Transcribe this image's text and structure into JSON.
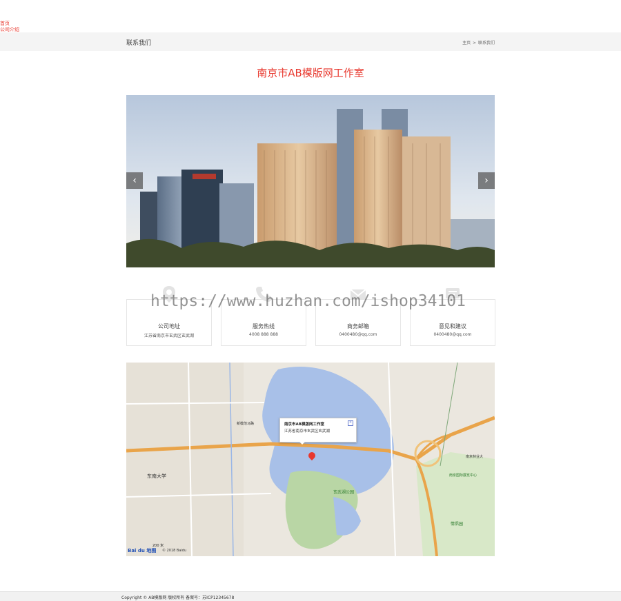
{
  "nav": {
    "home": "首页",
    "about": "公司介绍"
  },
  "header": {
    "title": "联系我们",
    "breadcrumb_home": "主页",
    "breadcrumb_sep": ">",
    "breadcrumb_current": "联系我们"
  },
  "company_name": "南京市AB模版网工作室",
  "banner": {
    "prev": "‹",
    "next": "›"
  },
  "watermark": "https://www.huzhan.com/ishop34101",
  "contact_cards": [
    {
      "icon": "location-pin-icon",
      "label": "公司地址",
      "value": "江苏省南京市玄武区玄武湖"
    },
    {
      "icon": "phone-icon",
      "label": "服务热线",
      "value": "4008 888 888"
    },
    {
      "icon": "mail-icon",
      "label": "商务邮箱",
      "value": "0400480@qq.com"
    },
    {
      "icon": "message-icon",
      "label": "意见和建议",
      "value": "0400480@qq.com"
    }
  ],
  "map": {
    "popup_title": "南京市AB模版网工作室",
    "popup_address": "江苏省南京市玄武区玄武湖",
    "popup_close": "×",
    "provider": "Bai du 地图",
    "scale": "200 米",
    "copyright": "© 2018 Baidu",
    "labels": {
      "park": "玄武湖公园",
      "university": "东南大学",
      "center": "南京国际展览中心",
      "forest_univ": "南京林业大",
      "love_garden": "情侣园",
      "xinmofan": "新模范马路"
    }
  },
  "footer": {
    "copyright": "Copyright © AB模版网 版权所有 备案号：苏ICP12345678"
  },
  "colors": {
    "accent": "#e8382e",
    "crumb_bg": "#f4f4f4",
    "lake": "#a8c0e8",
    "road": "#e9a44a"
  }
}
